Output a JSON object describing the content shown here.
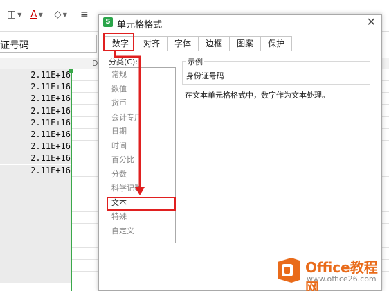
{
  "toolbar": {
    "items": [
      "fill-color",
      "font-color",
      "eraser",
      "align"
    ],
    "glyphs": [
      "◫",
      "A",
      "◇",
      "≡"
    ]
  },
  "formula_bar": {
    "value": "证号码"
  },
  "sheet": {
    "column_header": "D",
    "cell_values": [
      "2.11E+16",
      "2.11E+16",
      "2.11E+16",
      "2.11E+16",
      "2.11E+16",
      "2.11E+16",
      "2.11E+16",
      "2.11E+16",
      "2.11E+16"
    ]
  },
  "dialog": {
    "logo": "S",
    "title": "单元格格式",
    "close": "✕",
    "tabs": [
      "数字",
      "对齐",
      "字体",
      "边框",
      "图案",
      "保护"
    ],
    "category_label": "分类(C):",
    "categories": [
      "常规",
      "数值",
      "货币",
      "会计专用",
      "日期",
      "时间",
      "百分比",
      "分数",
      "科学记数",
      "文本",
      "特殊",
      "自定义"
    ],
    "selected_category": "文本",
    "sample_label": "示例",
    "sample_value": "身份证号码",
    "description": "在文本单元格格式中，数字作为文本处理。"
  },
  "watermark": {
    "title": "Office教程网",
    "url": "www.office26.com"
  },
  "colors": {
    "accent_green": "#3aa84a",
    "annotation_red": "#e02020",
    "watermark_orange": "#e96b1a"
  }
}
